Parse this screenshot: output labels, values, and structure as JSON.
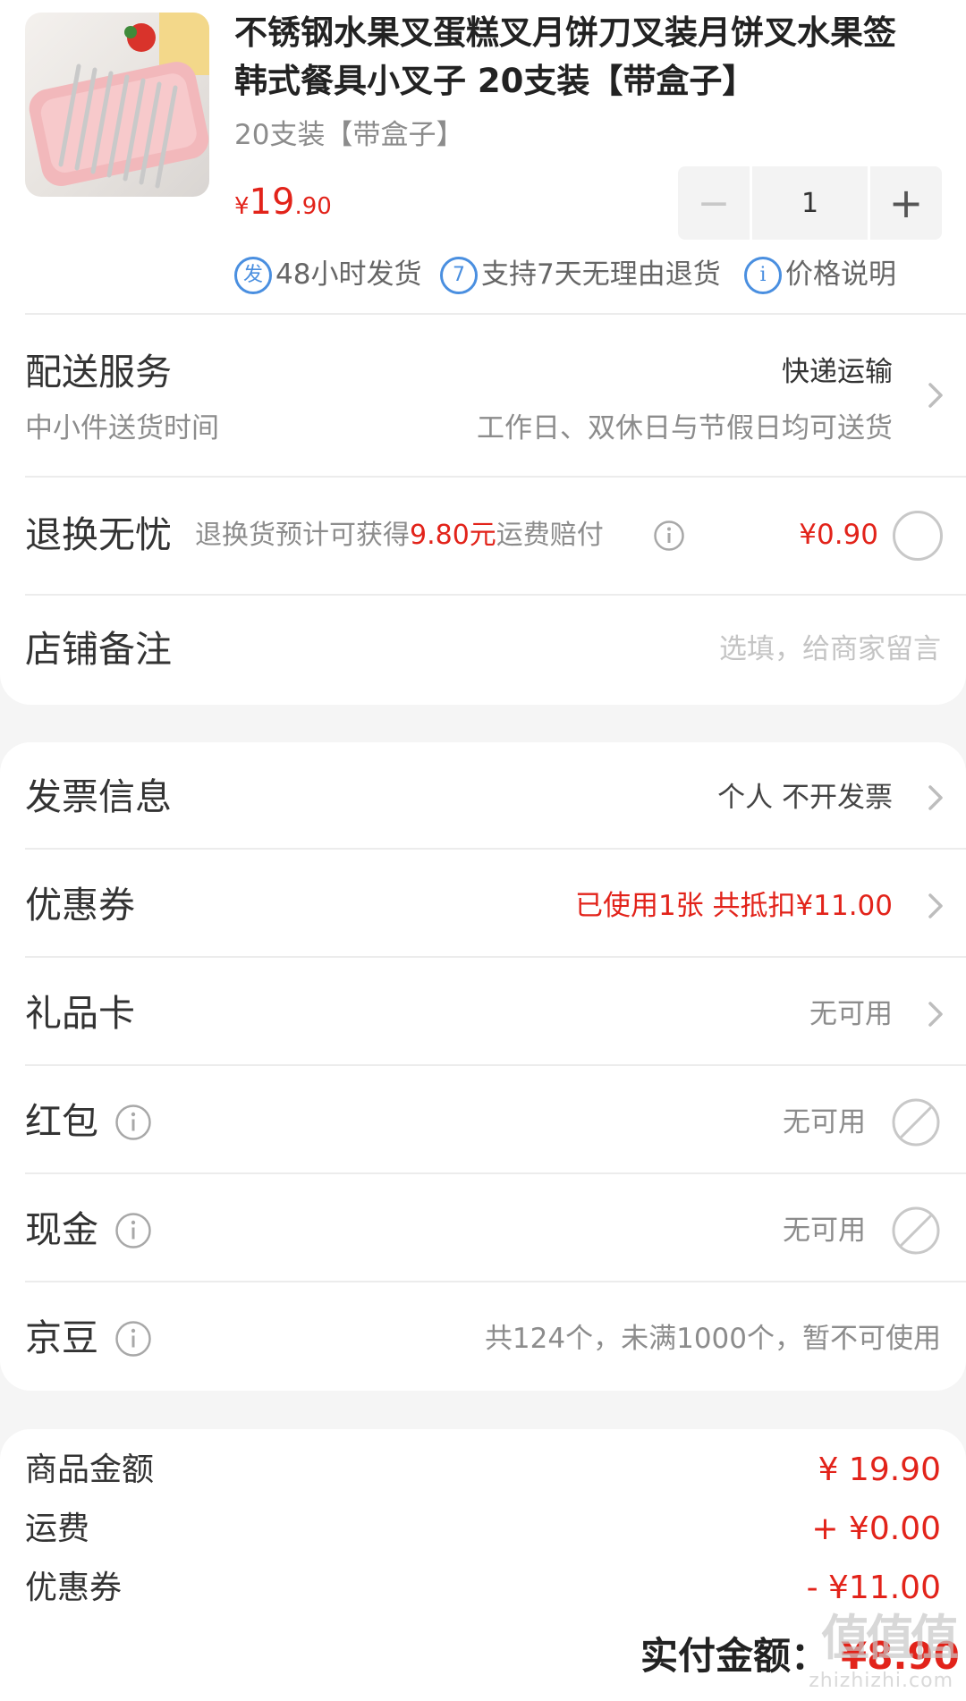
{
  "product": {
    "title_line1": "不锈钢水果叉蛋糕叉月饼刀叉装月饼叉水果签",
    "title_line2": "韩式餐具小叉子 20支装【带盒子】",
    "spec": "20支装【带盒子】",
    "price_symbol": "¥",
    "price_int": "19",
    "price_dec": ".90",
    "quantity": "1",
    "minus_label": "−",
    "plus_label": "+",
    "tags": [
      {
        "icon_text": "发",
        "icon": "ship-badge-icon",
        "text": "48小时发货"
      },
      {
        "icon_text": "7",
        "icon": "seven-day-badge-icon",
        "text": "支持7天无理由退货"
      },
      {
        "icon_text": "i",
        "icon": "info-badge-icon",
        "text": "价格说明"
      }
    ]
  },
  "delivery": {
    "label": "配送服务",
    "method": "快递运输",
    "sub_label": "中小件送货时间",
    "sub_value": "工作日、双休日与节假日均可送货"
  },
  "return_insurance": {
    "label": "退换无忧",
    "desc_prefix": "退换货预计可获得",
    "desc_amount": "9.80元",
    "desc_suffix": "运费赔付",
    "price": "¥0.90"
  },
  "note": {
    "label": "店铺备注",
    "placeholder": "选填，给商家留言"
  },
  "rows": {
    "invoice": {
      "label": "发票信息",
      "value": "个人 不开发票"
    },
    "coupon": {
      "label": "优惠券",
      "value": "已使用1张 共抵扣¥11.00"
    },
    "giftcard": {
      "label": "礼品卡",
      "value": "无可用"
    },
    "redpacket": {
      "label": "红包",
      "value": "无可用"
    },
    "cash": {
      "label": "现金",
      "value": "无可用"
    },
    "jingdou": {
      "label": "京豆",
      "value": "共124个，未满1000个，暂不可使用"
    }
  },
  "summary": {
    "goods_label": "商品金额",
    "goods_value": "¥ 19.90",
    "shipping_label": "运费",
    "shipping_value": "+ ¥0.00",
    "coupon_label": "优惠券",
    "coupon_value": "- ¥11.00",
    "total_label": "实付金额：",
    "total_value": "¥8.90"
  },
  "watermark": {
    "site": "zhizhizhi.com",
    "logo": "值值值"
  },
  "colors": {
    "accent_red": "#e2231a",
    "info_blue": "#4a8fe0",
    "text_gray": "#8c8c8c"
  }
}
